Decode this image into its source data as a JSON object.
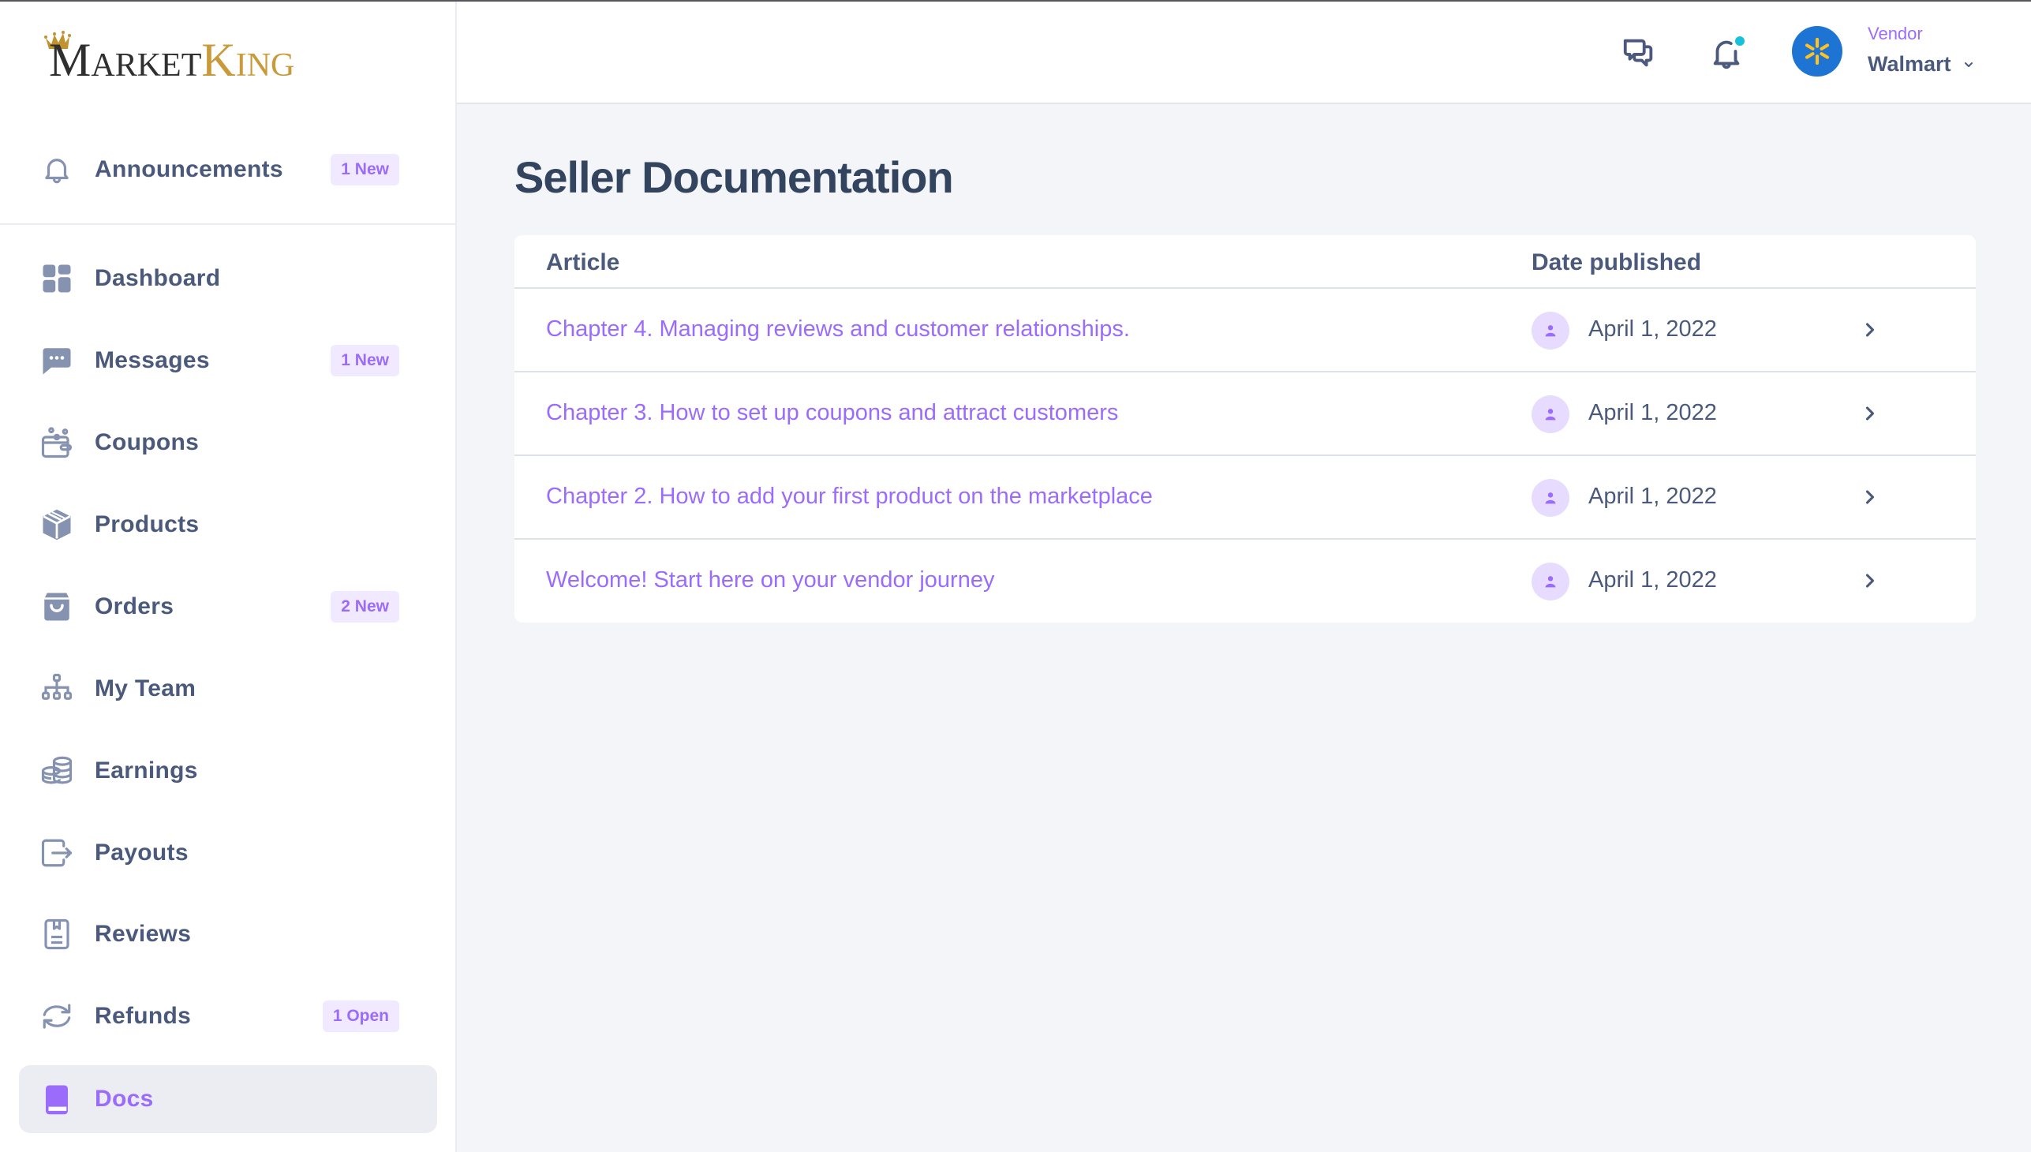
{
  "app": {
    "brand_part1_initial": "M",
    "brand_part1_rest": "ARKET",
    "brand_part2_initial": "K",
    "brand_part2_rest": "ING",
    "brand_colors": {
      "dark": "#2f2f2f",
      "gold": "#c99a3a"
    }
  },
  "sidebar": {
    "announcements": {
      "label": "Announcements",
      "icon": "bell-icon",
      "badge": "1 New"
    },
    "items": [
      {
        "label": "Dashboard",
        "icon": "grid-icon",
        "badge": null,
        "active": false
      },
      {
        "label": "Messages",
        "icon": "chat-bubble-icon",
        "badge": "1 New",
        "active": false
      },
      {
        "label": "Coupons",
        "icon": "wallet-coupon-icon",
        "badge": null,
        "active": false
      },
      {
        "label": "Products",
        "icon": "box-icon",
        "badge": null,
        "active": false
      },
      {
        "label": "Orders",
        "icon": "shopping-bag-icon",
        "badge": "2 New",
        "active": false
      },
      {
        "label": "My Team",
        "icon": "org-chart-icon",
        "badge": null,
        "active": false
      },
      {
        "label": "Earnings",
        "icon": "coins-icon",
        "badge": null,
        "active": false
      },
      {
        "label": "Payouts",
        "icon": "wallet-export-icon",
        "badge": null,
        "active": false
      },
      {
        "label": "Reviews",
        "icon": "document-bookmark-icon",
        "badge": null,
        "active": false
      },
      {
        "label": "Refunds",
        "icon": "refresh-icon",
        "badge": "1 Open",
        "active": false
      },
      {
        "label": "Docs",
        "icon": "book-icon",
        "badge": null,
        "active": true
      }
    ]
  },
  "header": {
    "messages_icon": "chat-icon",
    "notifications_icon": "bell-icon",
    "has_unread_notifications": true,
    "vendor_role": "Vendor",
    "vendor_name": "Walmart",
    "accent": "#9b6cfb"
  },
  "main": {
    "title": "Seller Documentation",
    "table": {
      "columns": [
        "Article",
        "Date published"
      ],
      "rows": [
        {
          "title": "Chapter 4. Managing reviews and customer relationships.",
          "date": "April 1, 2022"
        },
        {
          "title": "Chapter 3. How to set up coupons and attract customers",
          "date": "April 1, 2022"
        },
        {
          "title": "Chapter 2. How to add your first product on the marketplace",
          "date": "April 1, 2022"
        },
        {
          "title": "Welcome! Start here on your vendor journey",
          "date": "April 1, 2022"
        }
      ]
    }
  }
}
